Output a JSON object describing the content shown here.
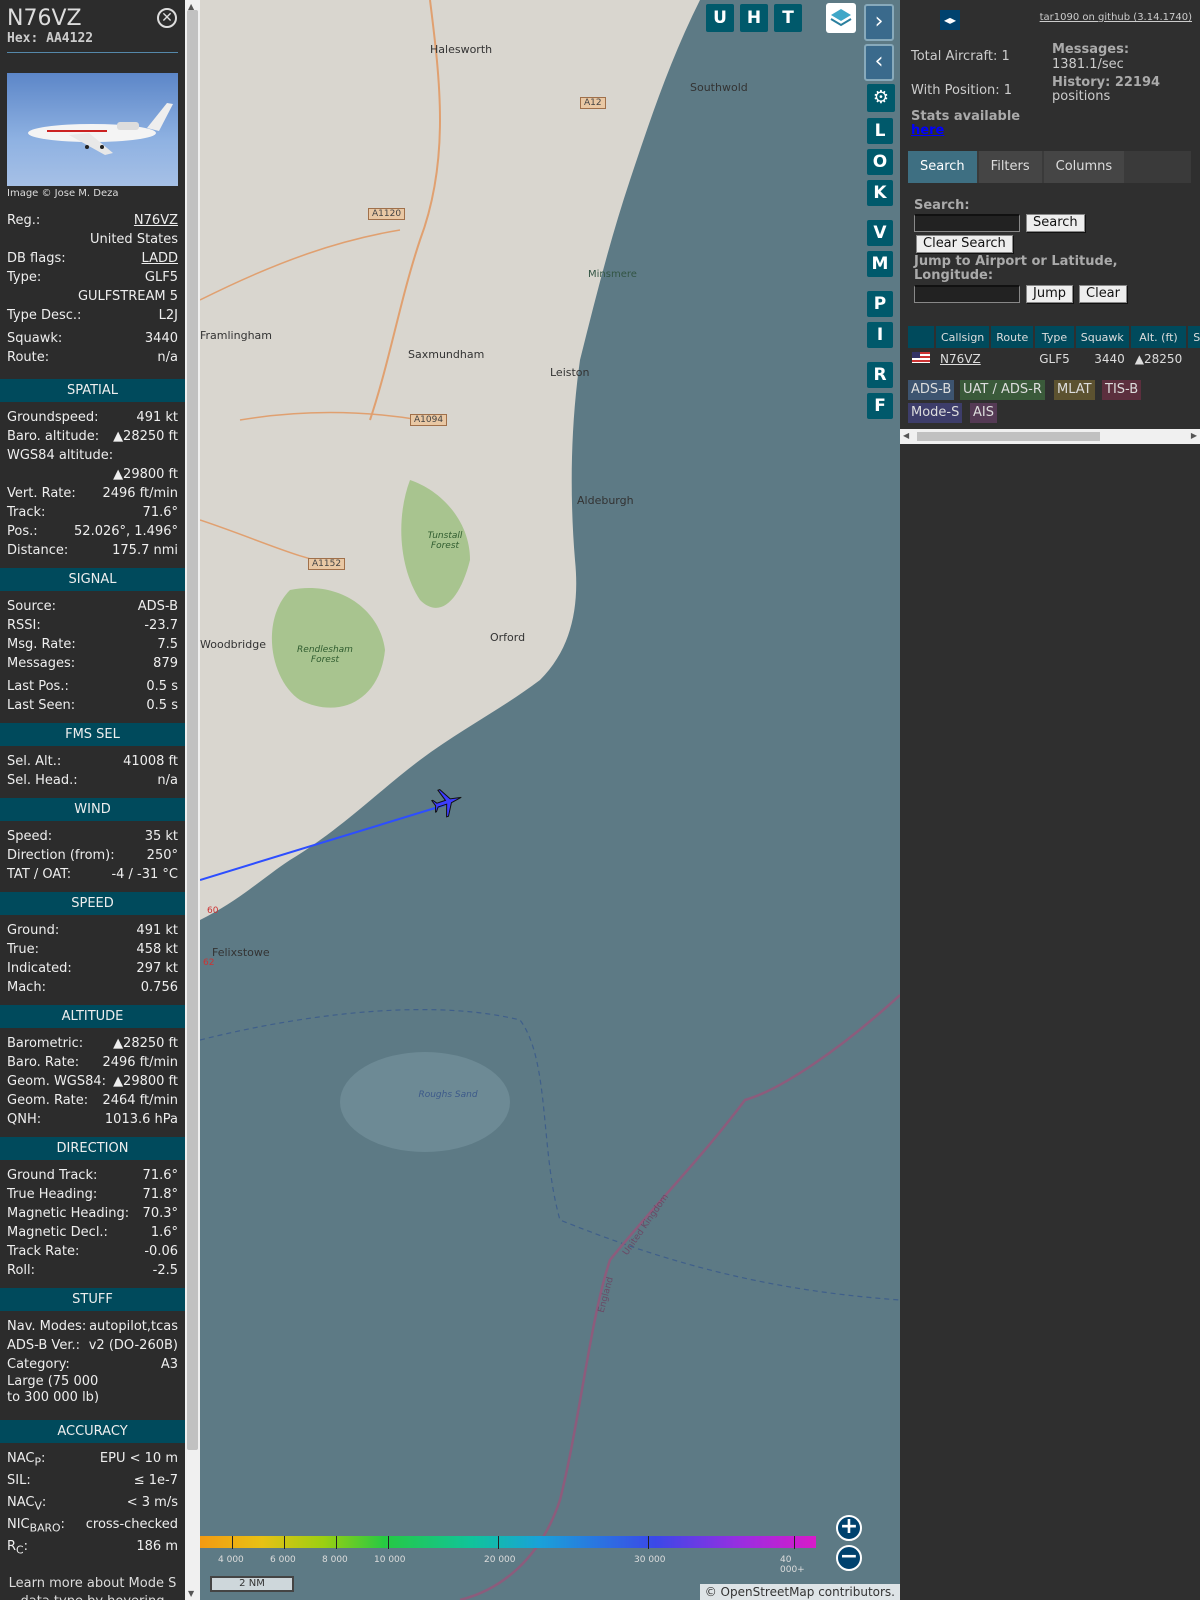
{
  "aircraft": {
    "callsign": "N76VZ",
    "hex": "Hex: AA4122",
    "photo_credit": "Image © Jose M. Deza"
  },
  "info": [
    {
      "k": "Reg.:",
      "v": "N76VZ"
    },
    {
      "k": "",
      "v": "United States"
    },
    {
      "k": "DB flags:",
      "v": "LADD"
    },
    {
      "k": "Type:",
      "v": "GLF5"
    },
    {
      "k": "",
      "v": "GULFSTREAM 5"
    },
    {
      "k": "Type Desc.:",
      "v": "L2J"
    },
    {
      "k": "Squawk:",
      "v": "3440"
    },
    {
      "k": "Route:",
      "v": "n/a"
    }
  ],
  "sections": [
    {
      "title": "SPATIAL",
      "rows": [
        {
          "k": "Groundspeed:",
          "v": "491 kt"
        },
        {
          "k": "Baro. altitude:",
          "v": "▲28250 ft"
        },
        {
          "k": "WGS84 altitude:",
          "v": ""
        },
        {
          "k": "",
          "v": "▲29800 ft"
        },
        {
          "k": "Vert. Rate:",
          "v": "2496 ft/min"
        },
        {
          "k": "Track:",
          "v": "71.6°"
        },
        {
          "k": "Pos.:",
          "v": "52.026°, 1.496°"
        },
        {
          "k": "Distance:",
          "v": "175.7 nmi"
        }
      ]
    },
    {
      "title": "SIGNAL",
      "rows": [
        {
          "k": "Source:",
          "v": "ADS-B"
        },
        {
          "k": "RSSI:",
          "v": "-23.7"
        },
        {
          "k": "Msg. Rate:",
          "v": "7.5"
        },
        {
          "k": "Messages:",
          "v": "879"
        },
        {
          "k": "Last Pos.:",
          "v": "0.5 s"
        },
        {
          "k": "Last Seen:",
          "v": "0.5 s"
        }
      ]
    },
    {
      "title": "FMS SEL",
      "rows": [
        {
          "k": "Sel. Alt.:",
          "v": "41008 ft"
        },
        {
          "k": "Sel. Head.:",
          "v": "n/a"
        }
      ]
    },
    {
      "title": "WIND",
      "rows": [
        {
          "k": "Speed:",
          "v": "35 kt"
        },
        {
          "k": "Direction (from):",
          "v": "250°"
        },
        {
          "k": "TAT / OAT:",
          "v": "-4 / -31 °C"
        }
      ]
    },
    {
      "title": "SPEED",
      "rows": [
        {
          "k": "Ground:",
          "v": "491 kt"
        },
        {
          "k": "True:",
          "v": "458 kt"
        },
        {
          "k": "Indicated:",
          "v": "297 kt"
        },
        {
          "k": "Mach:",
          "v": "0.756"
        }
      ]
    },
    {
      "title": "ALTITUDE",
      "rows": [
        {
          "k": "Barometric:",
          "v": "▲28250 ft"
        },
        {
          "k": "Baro. Rate:",
          "v": "2496 ft/min"
        },
        {
          "k": "Geom. WGS84:",
          "v": "▲29800 ft"
        },
        {
          "k": "Geom. Rate:",
          "v": "2464 ft/min"
        },
        {
          "k": "QNH:",
          "v": "1013.6 hPa"
        }
      ]
    },
    {
      "title": "DIRECTION",
      "rows": [
        {
          "k": "Ground Track:",
          "v": "71.6°"
        },
        {
          "k": "True Heading:",
          "v": "71.8°"
        },
        {
          "k": "Magnetic Heading:",
          "v": "70.3°"
        },
        {
          "k": "Magnetic Decl.:",
          "v": "1.6°"
        },
        {
          "k": "Track Rate:",
          "v": "-0.06"
        },
        {
          "k": "Roll:",
          "v": "-2.5"
        }
      ]
    }
  ],
  "stuff": {
    "title": "STUFF",
    "nav_k": "Nav. Modes:",
    "nav_v": "autopilot,tcas",
    "adsb_k": "ADS-B Ver.:",
    "adsb_v": "v2 (DO-260B)",
    "cat_k": "Category:",
    "cat_v": "A3",
    "cat_desc": "Large (75 000 to 300 000 lb)"
  },
  "accuracy": {
    "title": "ACCURACY",
    "nacp_k": "NAC",
    "nacp_sub": "P",
    "nacp_v": "EPU < 10 m",
    "sil_k": "SIL:",
    "sil_v": "≤ 1e-7",
    "nacv_k": "NAC",
    "nacv_sub": "V",
    "nacv_v": "< 3 m/s",
    "nic_k": "NIC",
    "nic_sub": "BARO",
    "nic_v": "cross-checked",
    "rc_k": "R",
    "rc_sub": "C",
    "rc_v": "186 m"
  },
  "footer": "Learn more about Mode S data type by hovering over each data label",
  "map": {
    "top_buttons": [
      "U",
      "H",
      "T"
    ],
    "side_buttons": [
      "L",
      "O",
      "K",
      "V",
      "M",
      "P",
      "I",
      "R",
      "F"
    ],
    "places": [
      {
        "name": "Halesworth"
      },
      {
        "name": "Southwold"
      },
      {
        "name": "Minsmere"
      },
      {
        "name": "Framlingham"
      },
      {
        "name": "Saxmundham"
      },
      {
        "name": "Leiston"
      },
      {
        "name": "Aldeburgh"
      },
      {
        "name": "Tunstall Forest"
      },
      {
        "name": "Orford"
      },
      {
        "name": "Rendlesham Forest"
      },
      {
        "name": "Woodbridge"
      },
      {
        "name": "Felixstowe"
      },
      {
        "name": "Roughs Sand"
      },
      {
        "name": "United Kingdom"
      },
      {
        "name": "England"
      }
    ],
    "roads": [
      "A12",
      "A1120",
      "A1094",
      "A1152",
      "60",
      "62"
    ],
    "legend": [
      "4 000",
      "6 000",
      "8 000",
      "10 000",
      "20 000",
      "30 000",
      "40 000+"
    ],
    "scale": "2 NM",
    "attribution": "© OpenStreetMap contributors."
  },
  "right": {
    "github": "tar1090 on github (3.14.1740)",
    "total": "Total Aircraft: 1",
    "with_pos": "With Position: 1",
    "messages_lbl": "Messages:",
    "messages_val": "1381.1/sec",
    "history_lbl": "History: 22194",
    "history_val": "positions",
    "stats": "Stats available",
    "here": "here",
    "tabs": [
      "Search",
      "Filters",
      "Columns"
    ],
    "search_lbl": "Search:",
    "search_btn": "Search",
    "clear_search": "Clear Search",
    "jump_lbl": "Jump to Airport or Latitude, Longitude:",
    "jump_btn": "Jump",
    "clear_btn": "Clear",
    "columns": [
      "",
      "Callsign",
      "Route",
      "Type",
      "Squawk",
      "Alt. (ft)",
      "Spd"
    ],
    "row": {
      "callsign": "N76VZ",
      "route": "",
      "type": "GLF5",
      "squawk": "3440",
      "alt": "▲28250",
      "spd": ""
    },
    "badges": [
      {
        "label": "ADS-B",
        "color": "#3d5470"
      },
      {
        "label": "UAT / ADS-R",
        "color": "#3a5a3a"
      },
      {
        "label": "MLAT",
        "color": "#5c5230"
      },
      {
        "label": "TIS-B",
        "color": "#5c2f3e"
      },
      {
        "label": "Mode-S",
        "color": "#3d3d6a"
      },
      {
        "label": "AIS",
        "color": "#553a55"
      }
    ]
  }
}
